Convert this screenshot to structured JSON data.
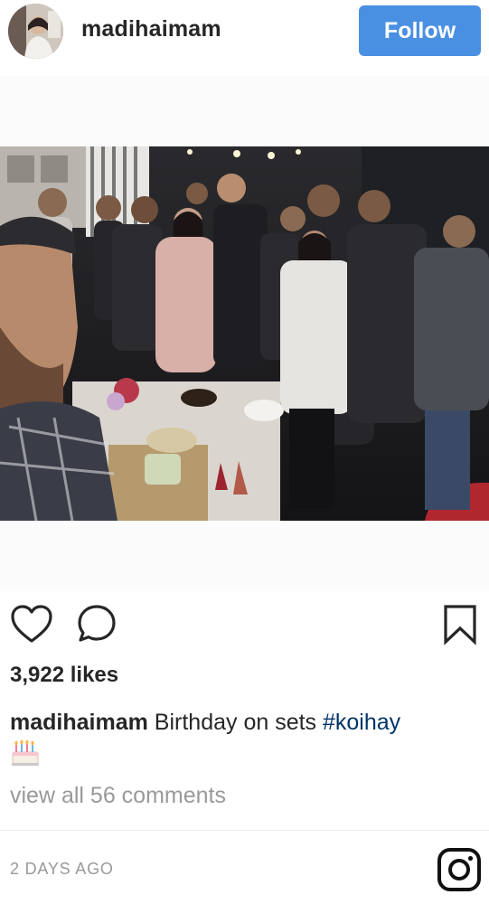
{
  "header": {
    "username": "madihaimam",
    "follow_label": "Follow",
    "accent": "#4a90e2"
  },
  "post": {
    "image_description_icon": "group-photo",
    "actions": {
      "like_icon": "heart-icon",
      "comment_icon": "comment-icon",
      "save_icon": "bookmark-icon"
    },
    "likes_text": "3,922 likes",
    "caption": {
      "username": "madihaimam",
      "text": " Birthday on sets ",
      "hashtag": "#koihay",
      "emoji": "birthday-cake-icon"
    },
    "comments_link": "view all 56 comments",
    "timestamp": "2 DAYS AGO",
    "footer_icon": "instagram-logo-icon"
  }
}
